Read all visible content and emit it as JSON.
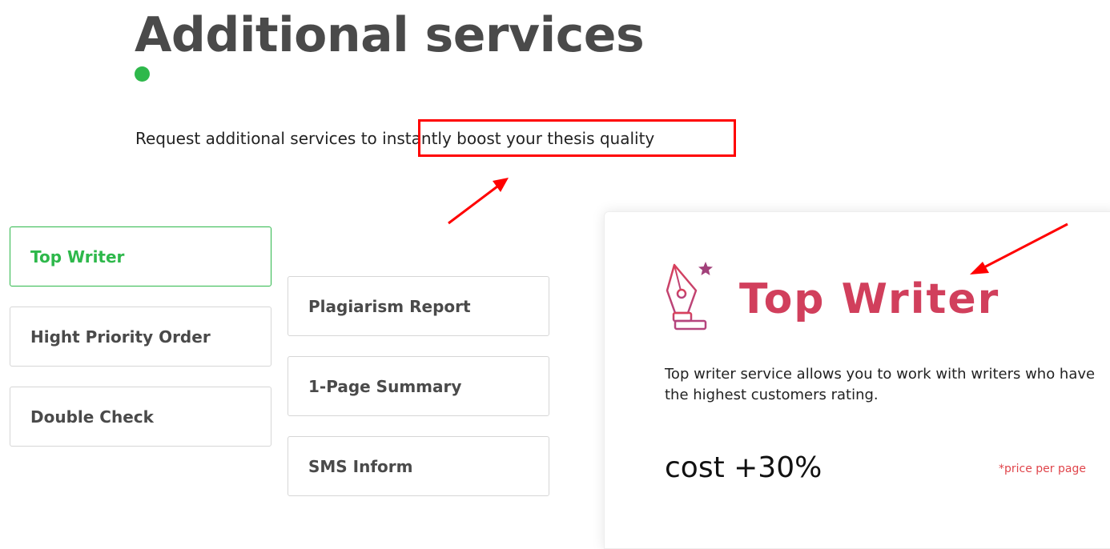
{
  "header": {
    "title": "Additional services",
    "subtitle_prefix": "Request additional services to ",
    "subtitle_highlight": "instantly boost your thesis quality"
  },
  "services": {
    "left": [
      {
        "label": "Top Writer",
        "active": true
      },
      {
        "label": "Hight Priority Order",
        "active": false
      },
      {
        "label": "Double Check",
        "active": false
      }
    ],
    "right": [
      {
        "label": "Plagiarism Report",
        "active": false
      },
      {
        "label": "1-Page Summary",
        "active": false
      },
      {
        "label": "SMS Inform",
        "active": false
      }
    ]
  },
  "detail": {
    "icon": "pen-nib-star-icon",
    "title": "Top Writer",
    "description": "Top writer service allows you to work with writers who have the highest customers rating.",
    "cost": "cost +30%",
    "note": "*price per page"
  },
  "colors": {
    "accent_green": "#2eb84b",
    "title_gray": "#4a4a4a",
    "card_title": "#d13f5c",
    "note_red": "#e0454b",
    "annotation_red": "#ff0000"
  }
}
